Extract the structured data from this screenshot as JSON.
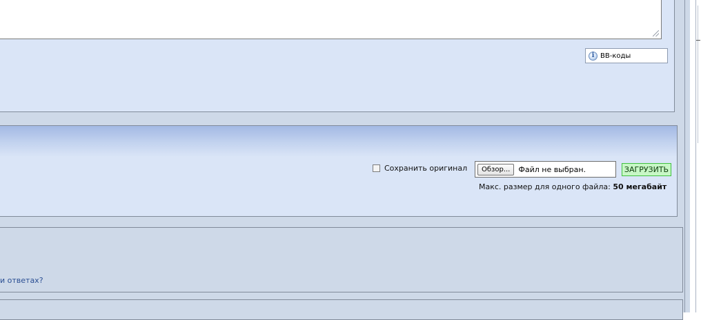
{
  "editor": {
    "bbcode_button_label": "BB-коды",
    "bbcode_icon": "info-icon"
  },
  "upload": {
    "keep_original_label": "Сохранить оригинал",
    "keep_original_checked": false,
    "browse_label": "Обзор...",
    "file_status": "Файл не выбран.",
    "upload_label": "ЗАГРУЗИТЬ",
    "max_size_text": "Макс. размер для одного файла:",
    "max_size_value": "50 мегабайт",
    "upload_button_color": "#c7f7c5"
  },
  "options": {
    "partial_link_text": "и ответах?"
  }
}
